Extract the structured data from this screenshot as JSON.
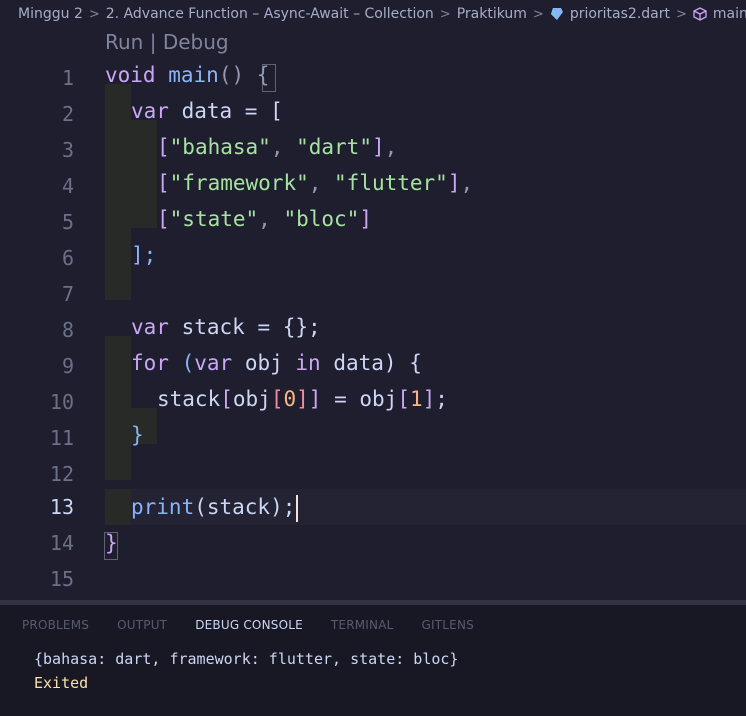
{
  "breadcrumb": {
    "items": [
      "Minggu 2",
      "2. Advance Function – Async-Await – Collection",
      "Praktikum",
      "prioritas2.dart",
      "main"
    ],
    "separator": ">"
  },
  "codelens": {
    "run": "Run",
    "divider": "|",
    "debug": "Debug"
  },
  "line_numbers": [
    "1",
    "2",
    "3",
    "4",
    "5",
    "6",
    "7",
    "8",
    "9",
    "10",
    "11",
    "12",
    "13",
    "14",
    "15"
  ],
  "active_line": 13,
  "code": {
    "l1_kw": "void",
    "l1_fn": "main",
    "l1_rest": "() {",
    "l2_kw": "var",
    "l2_rest": " data = [",
    "l3_s1": "\"bahasa\"",
    "l3_s2": "\"dart\"",
    "l4_s1": "\"framework\"",
    "l4_s2": "\"flutter\"",
    "l5_s1": "\"state\"",
    "l5_s2": "\"bloc\"",
    "l6": "];",
    "l8_kw": "var",
    "l8_rest": " stack = {};",
    "l9_kw": "for",
    "l9_kw2": "var",
    "l9_mid": " obj ",
    "l9_kw3": "in",
    "l9_rest": " data) {",
    "l10_a": "stack",
    "l10_b": "obj",
    "l10_n0": "0",
    "l10_c": "obj",
    "l10_n1": "1",
    "l11": "}",
    "l13_fn": "print",
    "l13_rest": "(stack);",
    "l14": "}"
  },
  "panel": {
    "tabs": [
      "PROBLEMS",
      "OUTPUT",
      "DEBUG CONSOLE",
      "TERMINAL",
      "GITLENS"
    ],
    "active_tab": "DEBUG CONSOLE",
    "output_line": "{bahasa: dart, framework: flutter, state: bloc}",
    "status_line": "Exited"
  },
  "colors": {
    "background": "#1e1e2e",
    "keyword": "#cba6f7",
    "function": "#89b4fa",
    "string": "#a6e3a1",
    "number": "#fab387",
    "exited": "#f9e2af"
  }
}
